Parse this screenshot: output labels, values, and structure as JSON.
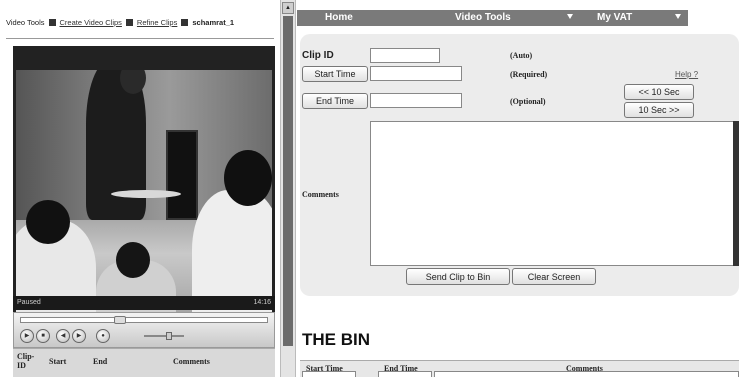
{
  "breadcrumb": {
    "root": "Video Tools",
    "link1": "Create Video Clips",
    "link2": "Refine Clips",
    "current": "schamrat_1"
  },
  "player": {
    "status": "Paused",
    "time": "14:16"
  },
  "clips_table": {
    "columns": [
      "Clip-ID",
      "Start",
      "End",
      "Comments"
    ]
  },
  "nav": {
    "home": "Home",
    "video_tools": "Video Tools",
    "my_vat": "My VAT"
  },
  "form": {
    "clip_id_label": "Clip ID",
    "clip_id_hint": "(Auto)",
    "start_time_button": "Start Time",
    "start_time_hint": "(Required)",
    "end_time_button": "End Time",
    "end_time_hint": "(Optional)",
    "help_link": "Help ?",
    "back_10_button": "<< 10 Sec",
    "fwd_10_button": "10 Sec >>",
    "comments_label": "Comments",
    "send_button": "Send Clip to Bin",
    "clear_button": "Clear Screen"
  },
  "bin": {
    "title": "THE BIN",
    "columns": [
      "Start Time",
      "End Time",
      "Comments"
    ]
  },
  "colors": {
    "nav_bg": "#7a7a7a",
    "panel_bg": "#ececec",
    "player_bg": "#222222"
  }
}
